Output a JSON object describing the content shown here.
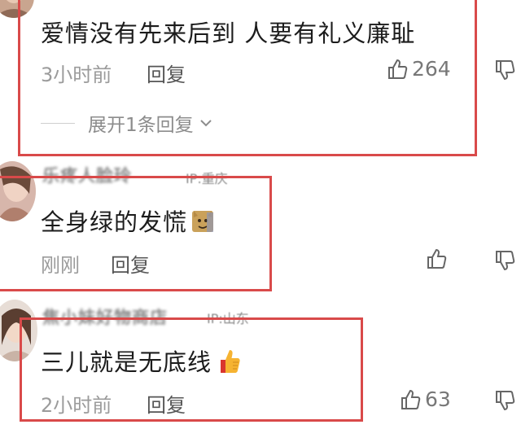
{
  "comments": [
    {
      "text": "爱情没有先来后到 人要有礼义廉耻",
      "time": "3小时前",
      "reply_label": "回复",
      "like_count": "264",
      "expand_label": "展开1条回复"
    },
    {
      "username": "乐疼人脸玲",
      "ip": "IP:重庆",
      "text": "全身绿的发慌",
      "emoji": "cat-face-emoji",
      "time": "刚刚",
      "reply_label": "回复",
      "like_count": ""
    },
    {
      "username": "焦小妹好物商店",
      "ip": "IP:山东",
      "text": "三儿就是无底线",
      "emoji": "thumbs-up-emoji",
      "time": "2小时前",
      "reply_label": "回复",
      "like_count": "63"
    }
  ],
  "colors": {
    "highlight_border": "#d94a4a",
    "meta_text": "#9b9b9b",
    "body_text": "#1c1c1c"
  }
}
